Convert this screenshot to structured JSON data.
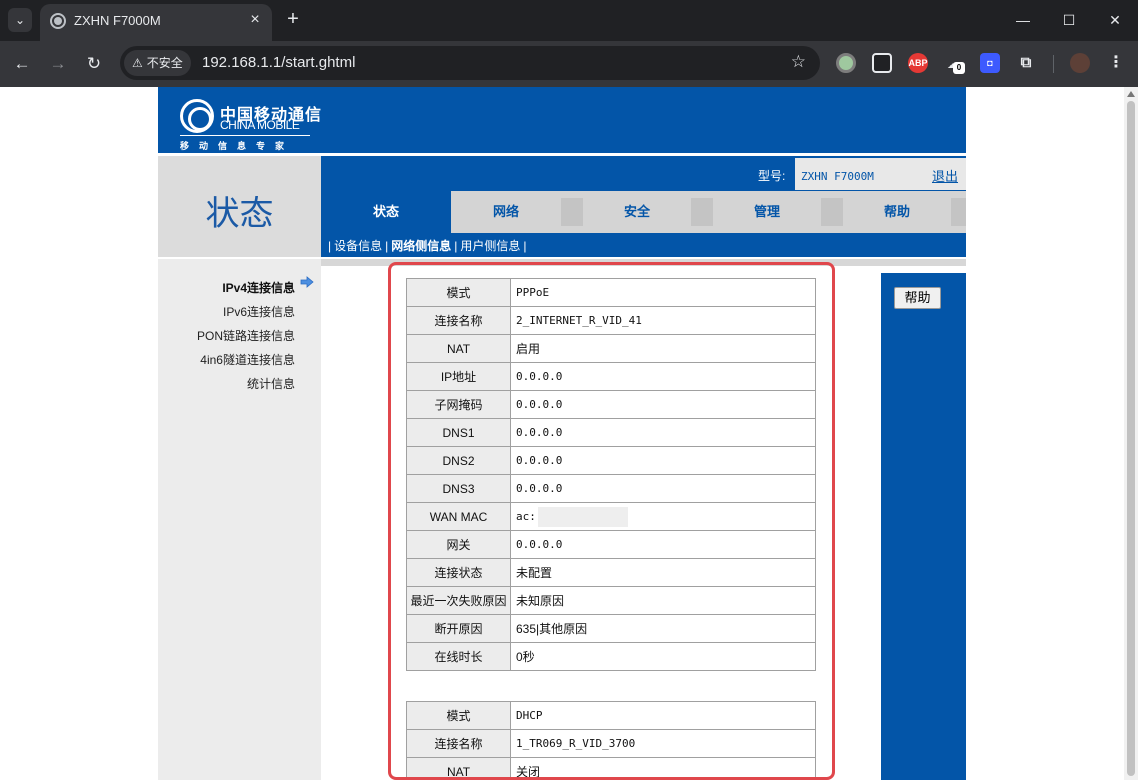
{
  "browser": {
    "tab_title": "ZXHN F7000M",
    "security_label": "不安全",
    "url": "192.168.1.1/start.ghtml",
    "extension_badge": "0"
  },
  "header": {
    "logo_cn": "中国移动通信",
    "logo_en": "CHINA MOBILE",
    "logo_slogan": "移动信息专家"
  },
  "status_title": "状态",
  "model": {
    "label": "型号:",
    "value": "ZXHN F7000M",
    "logout": "退出"
  },
  "main_tabs": [
    {
      "label": "状态",
      "active": true
    },
    {
      "label": "网络"
    },
    {
      "label": "安全"
    },
    {
      "label": "管理"
    },
    {
      "label": "帮助"
    }
  ],
  "sub_tabs": [
    {
      "label": "设备信息"
    },
    {
      "label": "网络侧信息",
      "active": true
    },
    {
      "label": "用户侧信息"
    }
  ],
  "sidebar": [
    {
      "label": "IPv4连接信息",
      "active": true
    },
    {
      "label": "IPv6连接信息"
    },
    {
      "label": "PON链路连接信息"
    },
    {
      "label": "4in6隧道连接信息"
    },
    {
      "label": "统计信息"
    }
  ],
  "help_button": "帮助",
  "connection1": [
    {
      "key": "模式",
      "value": "PPPoE"
    },
    {
      "key": "连接名称",
      "value": "2_INTERNET_R_VID_41"
    },
    {
      "key": "NAT",
      "value": "启用"
    },
    {
      "key": "IP地址",
      "value": "0.0.0.0"
    },
    {
      "key": "子网掩码",
      "value": "0.0.0.0"
    },
    {
      "key": "DNS1",
      "value": "0.0.0.0"
    },
    {
      "key": "DNS2",
      "value": "0.0.0.0"
    },
    {
      "key": "DNS3",
      "value": "0.0.0.0"
    },
    {
      "key": "WAN MAC",
      "value": "ac:"
    },
    {
      "key": "网关",
      "value": "0.0.0.0"
    },
    {
      "key": "连接状态",
      "value": "未配置"
    },
    {
      "key": "最近一次失败原因",
      "value": "未知原因"
    },
    {
      "key": "断开原因",
      "value": "635|其他原因"
    },
    {
      "key": "在线时长",
      "value": "0秒"
    }
  ],
  "connection2": [
    {
      "key": "模式",
      "value": "DHCP"
    },
    {
      "key": "连接名称",
      "value": "1_TR069_R_VID_3700"
    },
    {
      "key": "NAT",
      "value": "关闭"
    }
  ],
  "colors": {
    "brand_blue": "#0355a8",
    "highlight_red": "#e0474c"
  }
}
